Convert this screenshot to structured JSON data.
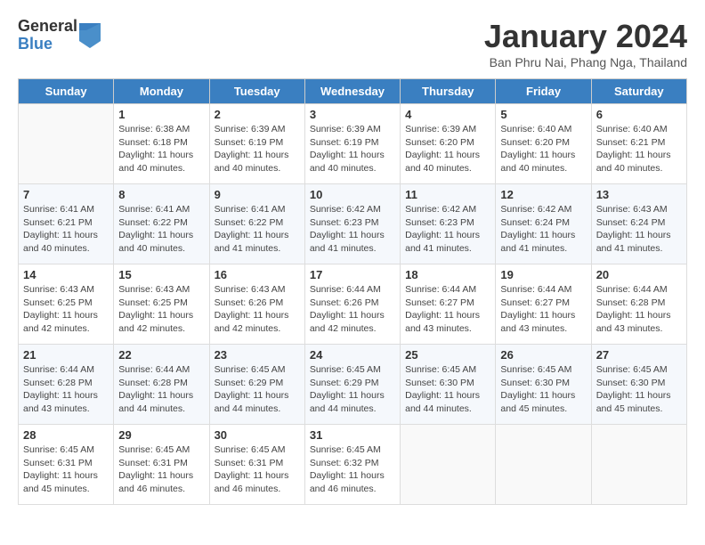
{
  "header": {
    "logo_general": "General",
    "logo_blue": "Blue",
    "title": "January 2024",
    "location": "Ban Phru Nai, Phang Nga, Thailand"
  },
  "columns": [
    "Sunday",
    "Monday",
    "Tuesday",
    "Wednesday",
    "Thursday",
    "Friday",
    "Saturday"
  ],
  "weeks": [
    [
      {
        "day": null
      },
      {
        "day": 1,
        "sunrise": "6:38 AM",
        "sunset": "6:18 PM",
        "daylight": "11 hours and 40 minutes."
      },
      {
        "day": 2,
        "sunrise": "6:39 AM",
        "sunset": "6:19 PM",
        "daylight": "11 hours and 40 minutes."
      },
      {
        "day": 3,
        "sunrise": "6:39 AM",
        "sunset": "6:19 PM",
        "daylight": "11 hours and 40 minutes."
      },
      {
        "day": 4,
        "sunrise": "6:39 AM",
        "sunset": "6:20 PM",
        "daylight": "11 hours and 40 minutes."
      },
      {
        "day": 5,
        "sunrise": "6:40 AM",
        "sunset": "6:20 PM",
        "daylight": "11 hours and 40 minutes."
      },
      {
        "day": 6,
        "sunrise": "6:40 AM",
        "sunset": "6:21 PM",
        "daylight": "11 hours and 40 minutes."
      }
    ],
    [
      {
        "day": 7,
        "sunrise": "6:41 AM",
        "sunset": "6:21 PM",
        "daylight": "11 hours and 40 minutes."
      },
      {
        "day": 8,
        "sunrise": "6:41 AM",
        "sunset": "6:22 PM",
        "daylight": "11 hours and 40 minutes."
      },
      {
        "day": 9,
        "sunrise": "6:41 AM",
        "sunset": "6:22 PM",
        "daylight": "11 hours and 41 minutes."
      },
      {
        "day": 10,
        "sunrise": "6:42 AM",
        "sunset": "6:23 PM",
        "daylight": "11 hours and 41 minutes."
      },
      {
        "day": 11,
        "sunrise": "6:42 AM",
        "sunset": "6:23 PM",
        "daylight": "11 hours and 41 minutes."
      },
      {
        "day": 12,
        "sunrise": "6:42 AM",
        "sunset": "6:24 PM",
        "daylight": "11 hours and 41 minutes."
      },
      {
        "day": 13,
        "sunrise": "6:43 AM",
        "sunset": "6:24 PM",
        "daylight": "11 hours and 41 minutes."
      }
    ],
    [
      {
        "day": 14,
        "sunrise": "6:43 AM",
        "sunset": "6:25 PM",
        "daylight": "11 hours and 42 minutes."
      },
      {
        "day": 15,
        "sunrise": "6:43 AM",
        "sunset": "6:25 PM",
        "daylight": "11 hours and 42 minutes."
      },
      {
        "day": 16,
        "sunrise": "6:43 AM",
        "sunset": "6:26 PM",
        "daylight": "11 hours and 42 minutes."
      },
      {
        "day": 17,
        "sunrise": "6:44 AM",
        "sunset": "6:26 PM",
        "daylight": "11 hours and 42 minutes."
      },
      {
        "day": 18,
        "sunrise": "6:44 AM",
        "sunset": "6:27 PM",
        "daylight": "11 hours and 43 minutes."
      },
      {
        "day": 19,
        "sunrise": "6:44 AM",
        "sunset": "6:27 PM",
        "daylight": "11 hours and 43 minutes."
      },
      {
        "day": 20,
        "sunrise": "6:44 AM",
        "sunset": "6:28 PM",
        "daylight": "11 hours and 43 minutes."
      }
    ],
    [
      {
        "day": 21,
        "sunrise": "6:44 AM",
        "sunset": "6:28 PM",
        "daylight": "11 hours and 43 minutes."
      },
      {
        "day": 22,
        "sunrise": "6:44 AM",
        "sunset": "6:28 PM",
        "daylight": "11 hours and 44 minutes."
      },
      {
        "day": 23,
        "sunrise": "6:45 AM",
        "sunset": "6:29 PM",
        "daylight": "11 hours and 44 minutes."
      },
      {
        "day": 24,
        "sunrise": "6:45 AM",
        "sunset": "6:29 PM",
        "daylight": "11 hours and 44 minutes."
      },
      {
        "day": 25,
        "sunrise": "6:45 AM",
        "sunset": "6:30 PM",
        "daylight": "11 hours and 44 minutes."
      },
      {
        "day": 26,
        "sunrise": "6:45 AM",
        "sunset": "6:30 PM",
        "daylight": "11 hours and 45 minutes."
      },
      {
        "day": 27,
        "sunrise": "6:45 AM",
        "sunset": "6:30 PM",
        "daylight": "11 hours and 45 minutes."
      }
    ],
    [
      {
        "day": 28,
        "sunrise": "6:45 AM",
        "sunset": "6:31 PM",
        "daylight": "11 hours and 45 minutes."
      },
      {
        "day": 29,
        "sunrise": "6:45 AM",
        "sunset": "6:31 PM",
        "daylight": "11 hours and 46 minutes."
      },
      {
        "day": 30,
        "sunrise": "6:45 AM",
        "sunset": "6:31 PM",
        "daylight": "11 hours and 46 minutes."
      },
      {
        "day": 31,
        "sunrise": "6:45 AM",
        "sunset": "6:32 PM",
        "daylight": "11 hours and 46 minutes."
      },
      {
        "day": null
      },
      {
        "day": null
      },
      {
        "day": null
      }
    ]
  ]
}
